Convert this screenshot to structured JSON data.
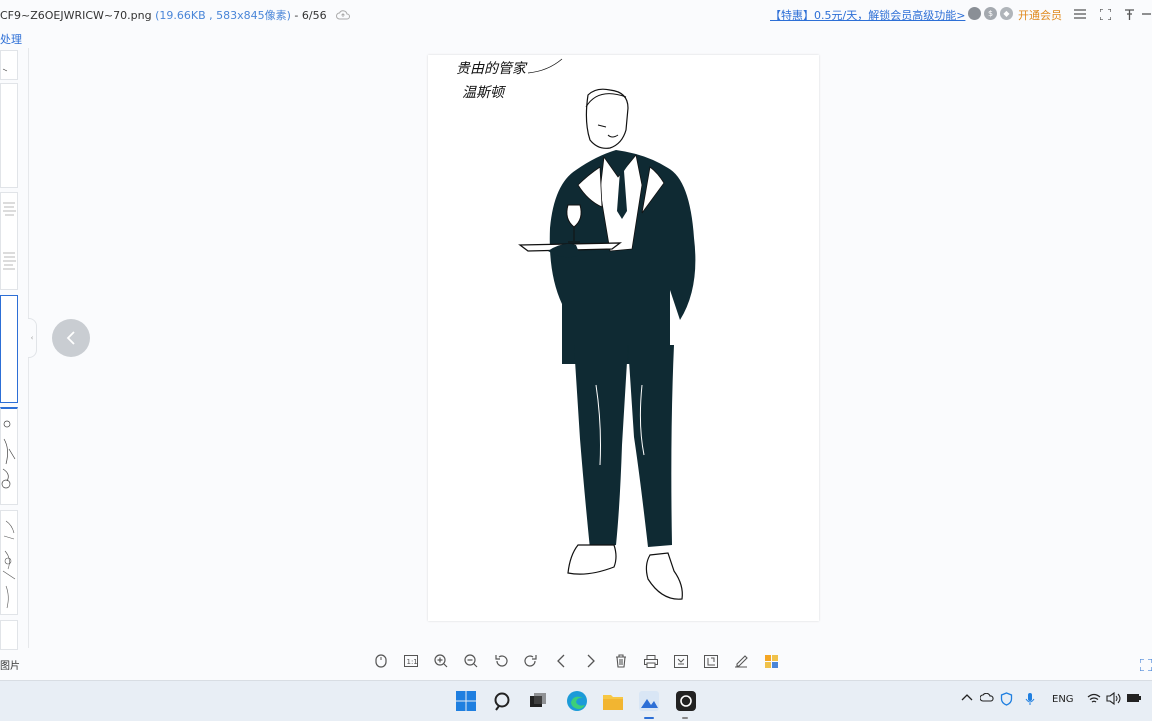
{
  "title": {
    "filename": "CF9~Z6OEJWRICW~70.png",
    "meta": "(19.66KB , 583x845像素)",
    "position": " - 6/56"
  },
  "promo": "【特惠】0.5元/天，解锁会员高级功能>",
  "vip_label": "开通会员",
  "sidebar": {
    "process_label": "处理"
  },
  "image": {
    "caption_line1": "贵由的管家",
    "caption_line2": "温斯顿"
  },
  "bottom": {
    "image_label": "图片"
  },
  "taskbar": {
    "lang": "ENG"
  },
  "icons": {
    "titlebar": [
      "cloud-upload-icon",
      "avatar-icon",
      "coin-icon",
      "badge-icon",
      "menu-icon",
      "fullscreen-icon",
      "pin-icon",
      "minimize-icon"
    ],
    "toolbar": [
      "mouse-icon",
      "actual-size-icon",
      "zoom-in-icon",
      "zoom-out-icon",
      "rotate-left-icon",
      "rotate-right-icon",
      "previous-icon",
      "next-icon",
      "delete-icon",
      "print-icon",
      "compare-icon",
      "crop-icon",
      "edit-icon",
      "apps-icon"
    ]
  },
  "colors": {
    "accent": "#2d6fd6",
    "vip": "#e08a1e",
    "ink": "#0f2a33"
  }
}
